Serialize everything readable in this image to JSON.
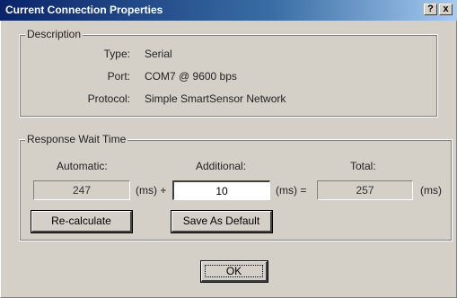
{
  "window": {
    "title": "Current Connection Properties",
    "help_label": "?",
    "close_label": "x"
  },
  "description": {
    "legend": "Description",
    "type_label": "Type:",
    "type_value": "Serial",
    "port_label": "Port:",
    "port_value": "COM7 @ 9600 bps",
    "protocol_label": "Protocol:",
    "protocol_value": "Simple SmartSensor Network"
  },
  "response": {
    "legend": "Response Wait Time",
    "automatic_label": "Automatic:",
    "additional_label": "Additional:",
    "total_label": "Total:",
    "automatic_value": "247",
    "additional_value": "10",
    "total_value": "257",
    "unit_plus": "(ms) +",
    "unit_equals": "(ms) =",
    "unit": "(ms)",
    "recalculate_label": "Re-calculate",
    "save_default_label": "Save As Default"
  },
  "footer": {
    "ok_label": "OK"
  }
}
